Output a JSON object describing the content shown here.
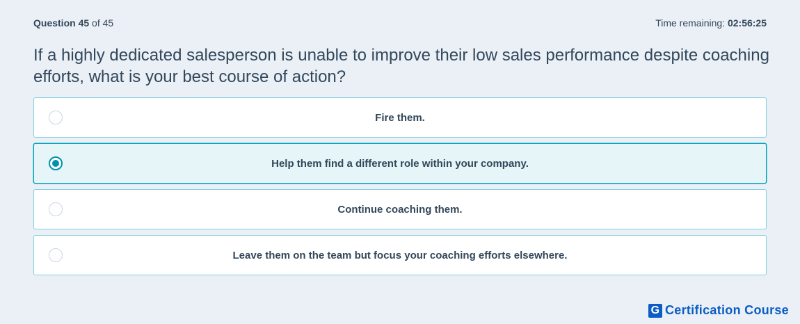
{
  "header": {
    "question_word": "Question",
    "question_number": "45",
    "of_total": "of 45",
    "time_label": "Time remaining:",
    "time_value": "02:56:25"
  },
  "question_text": "If a highly dedicated salesperson is unable to improve their low sales performance despite coaching efforts, what is your best course of action?",
  "options": [
    {
      "label": "Fire them.",
      "selected": false
    },
    {
      "label": "Help them find a different role within your company.",
      "selected": true
    },
    {
      "label": "Continue coaching them.",
      "selected": false
    },
    {
      "label": "Leave them on the team but focus your coaching efforts elsewhere.",
      "selected": false
    }
  ],
  "brand": {
    "logo_letter": "G",
    "logo_icon": "g-logo-icon",
    "name": "Certification Course"
  },
  "colors": {
    "background": "#eaf0f6",
    "text": "#33475b",
    "option_border": "#7fd1de",
    "selected_border": "#00a4bd",
    "selected_background": "#e5f5f8",
    "radio_selected": "#0091ae",
    "brand": "#0b5cc4"
  }
}
